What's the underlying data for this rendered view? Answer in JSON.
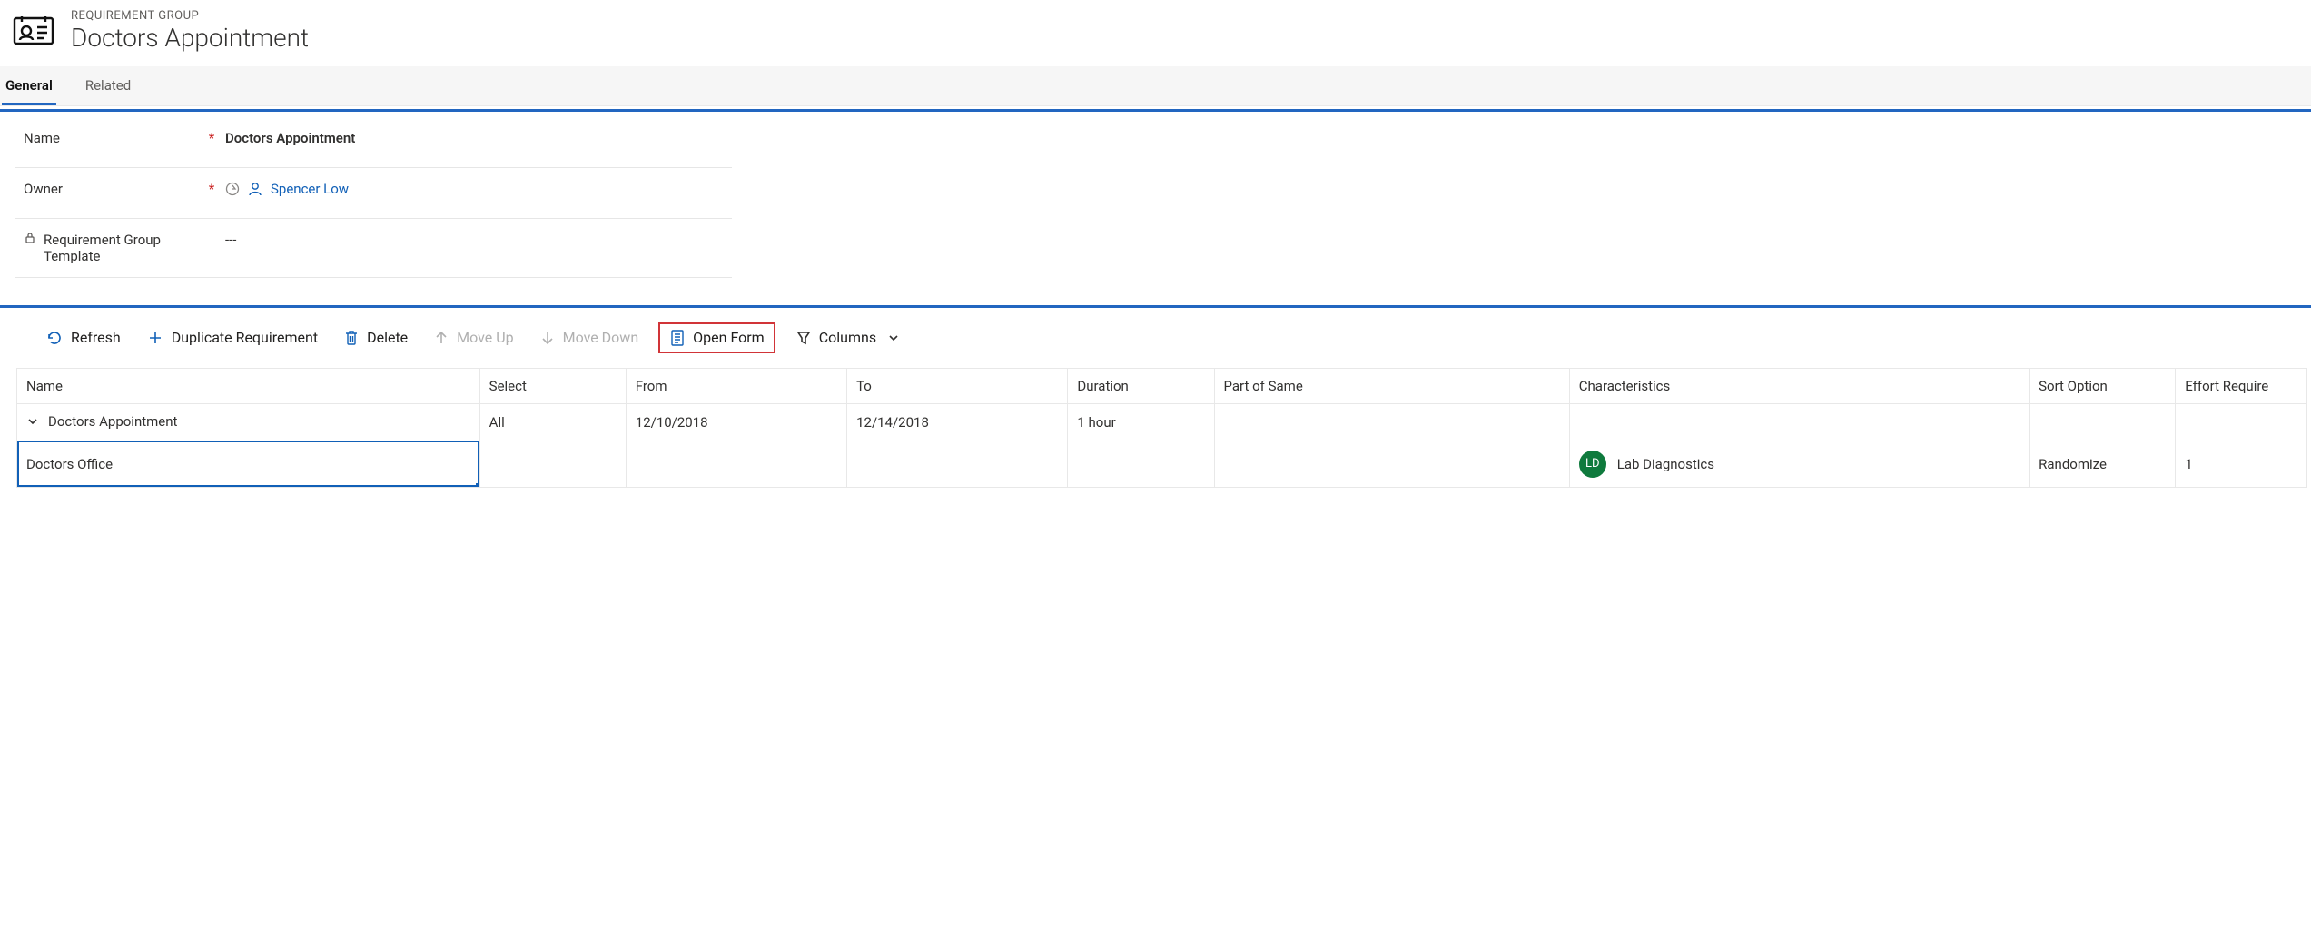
{
  "header": {
    "entity_type": "REQUIREMENT GROUP",
    "title": "Doctors Appointment"
  },
  "tabs": {
    "general": "General",
    "related": "Related"
  },
  "form": {
    "name_label": "Name",
    "name_value": "Doctors Appointment",
    "owner_label": "Owner",
    "owner_value": "Spencer Low",
    "template_label": "Requirement Group Template",
    "template_value": "---"
  },
  "toolbar": {
    "refresh": "Refresh",
    "duplicate": "Duplicate Requirement",
    "delete": "Delete",
    "move_up": "Move Up",
    "move_down": "Move Down",
    "open_form": "Open Form",
    "columns": "Columns"
  },
  "grid": {
    "columns": {
      "name": "Name",
      "select": "Select",
      "from": "From",
      "to": "To",
      "duration": "Duration",
      "part_of_same": "Part of Same",
      "characteristics": "Characteristics",
      "sort_option": "Sort Option",
      "effort_required": "Effort Require"
    },
    "rows": [
      {
        "name": "Doctors Appointment",
        "select": "All",
        "from": "12/10/2018",
        "to": "12/14/2018",
        "duration": "1 hour",
        "part_of_same": "",
        "characteristics": "",
        "badge": "",
        "sort_option": "",
        "effort_required": ""
      },
      {
        "name": "Doctors Office",
        "select": "",
        "from": "",
        "to": "",
        "duration": "",
        "part_of_same": "",
        "characteristics": "Lab Diagnostics",
        "badge": "LD",
        "sort_option": "Randomize",
        "effort_required": "1"
      }
    ]
  }
}
